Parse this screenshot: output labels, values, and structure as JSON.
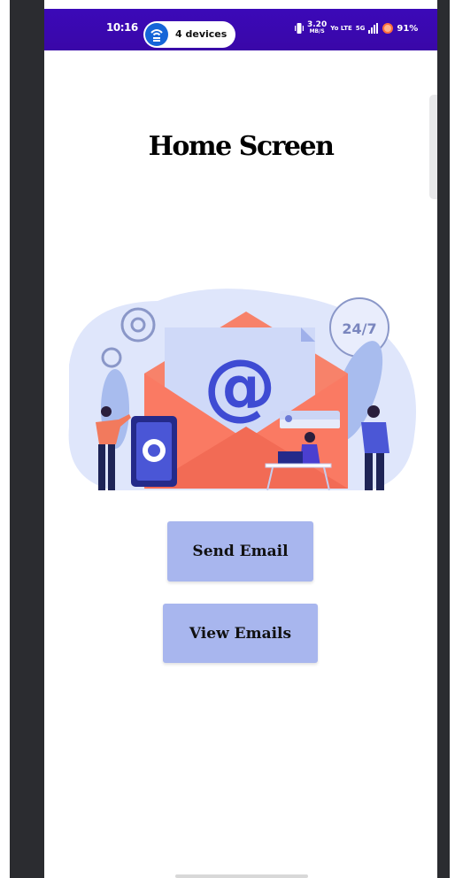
{
  "status_bar": {
    "time": "10:16",
    "hotspot_label": "4 devices",
    "speed_value": "3.20",
    "speed_unit": "MB/S",
    "network_label": "Yo LTE",
    "signal_label": "5G",
    "battery_percent": "91%",
    "background_color": "#3a07a8"
  },
  "main": {
    "title": "Home Screen",
    "illustration_badge": "24/7",
    "illustration_symbol": "@"
  },
  "buttons": {
    "send_email_label": "Send Email",
    "view_emails_label": "View Emails",
    "button_color": "#a8b6ee"
  }
}
